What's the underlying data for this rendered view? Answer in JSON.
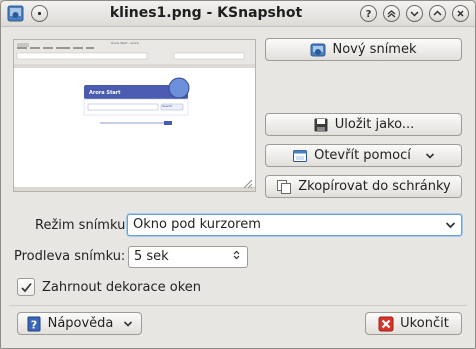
{
  "window": {
    "title": "klines1.png - KSnapshot"
  },
  "preview": {
    "browser_title": "Arora Start - Arora",
    "start_page_heading": "Arora Start",
    "search_button": "Search"
  },
  "buttons": {
    "new_snapshot": "Nový snímek",
    "save_as": "Uložit jako...",
    "open_with": "Otevřít pomocí",
    "copy_to_clipboard": "Zkopírovat do schránky",
    "help": "Nápověda",
    "quit": "Ukončit"
  },
  "capture_mode": {
    "label": "Režim snímku:",
    "value": "Okno pod kurzorem"
  },
  "snapshot_delay": {
    "label": "Prodleva snímku:",
    "value": "5 sek"
  },
  "include_decorations": {
    "label": "Zahrnout dekorace oken",
    "checked": true
  },
  "icons": {
    "app": "ksnapshot-icon",
    "help_titlebar": "help-icon",
    "minimize": "minimize-icon",
    "maximize": "maximize-icon",
    "close": "close-icon",
    "new_snapshot": "camera-icon",
    "save": "save-icon",
    "open": "open-icon",
    "copy": "copy-icon",
    "help": "help-book-icon",
    "quit": "quit-icon"
  },
  "colors": {
    "window_bg": "#e8e6e3",
    "focus": "#6aa1d6",
    "quit_red": "#d9342c"
  }
}
